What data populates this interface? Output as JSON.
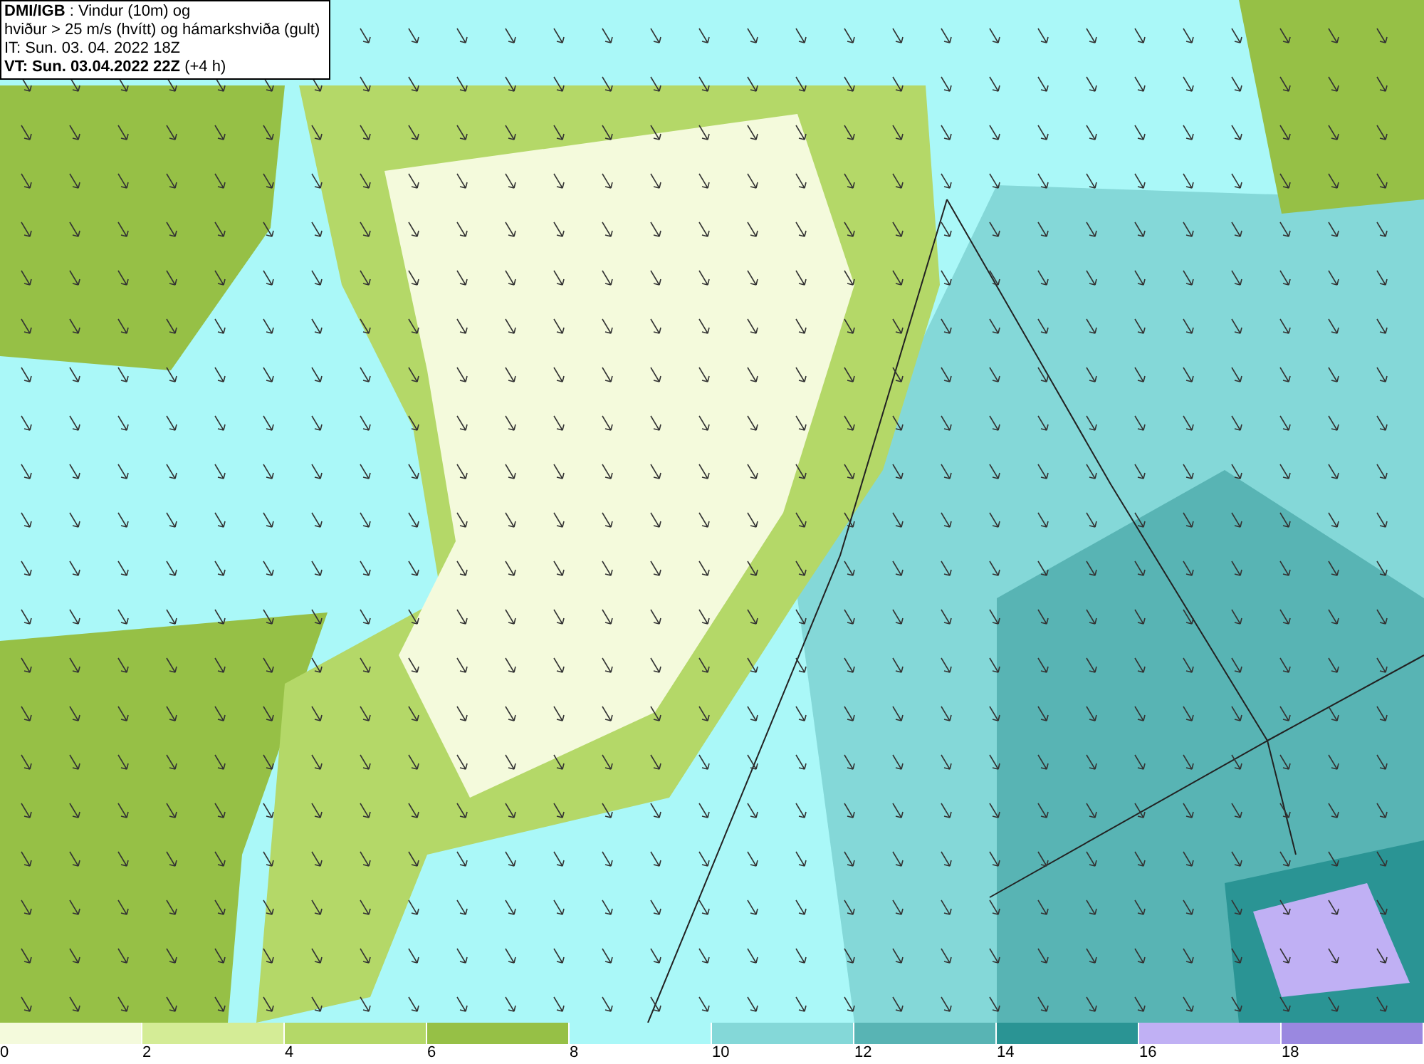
{
  "title_box": {
    "lines": [
      "**DMI/IGB** : Vindur (10m) og",
      "hviður > 25 m/s (hvítt) og hámarkshviða (gult)",
      "IT: Sun. 03. 04. 2022 18Z",
      "**VT: Sun. 03.04.2022 22Z** (+4 h)"
    ]
  },
  "legend": [
    {
      "color": "#f4fadc",
      "label": "0"
    },
    {
      "color": "#d4ec96",
      "label": "2"
    },
    {
      "color": "#b4d868",
      "label": "4"
    },
    {
      "color": "#96c046",
      "label": "6"
    },
    {
      "color": "#aaf8f8",
      "label": "8"
    },
    {
      "color": "#84d8d8",
      "label": "10"
    },
    {
      "color": "#58b4b4",
      "label": "12"
    },
    {
      "color": "#2a9494",
      "label": "14"
    },
    {
      "color": "#c0b0f4",
      "label": "16"
    },
    {
      "color": "#9a88e0",
      "label": "18"
    }
  ]
}
